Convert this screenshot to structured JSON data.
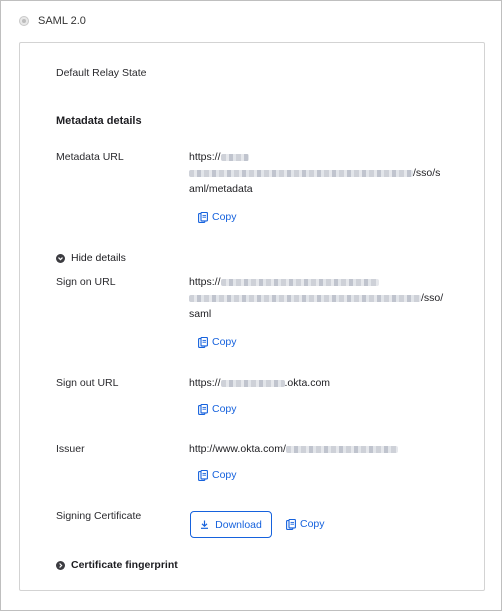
{
  "saml": {
    "label": "SAML 2.0"
  },
  "default_relay": {
    "label": "Default Relay State"
  },
  "metadata": {
    "heading": "Metadata details",
    "label": "Metadata URL",
    "line1": "https://",
    "line2_end": "/sso/s",
    "line3": "aml/metadata",
    "copy": "Copy"
  },
  "hide_details": {
    "label": "Hide details"
  },
  "sign_on": {
    "label": "Sign on URL",
    "line1": "https://",
    "line2_end": "/sso/",
    "line3": "saml",
    "copy": "Copy"
  },
  "sign_out": {
    "label": "Sign out URL",
    "prefix": "https://",
    "suffix": ".okta.com",
    "copy": "Copy"
  },
  "issuer": {
    "label": "Issuer",
    "prefix": "http://www.okta.com/",
    "copy": "Copy"
  },
  "signing_cert": {
    "label": "Signing Certificate",
    "download": "Download",
    "copy": "Copy"
  },
  "fingerprint": {
    "label": "Certificate fingerprint"
  },
  "colors": {
    "link": "#1662dd",
    "text": "#1d1d21",
    "border": "#d3d3d3"
  },
  "icons": [
    "radio-icon",
    "copy-icon",
    "chevron-down-circle-icon",
    "chevron-right-circle-icon",
    "download-icon"
  ]
}
